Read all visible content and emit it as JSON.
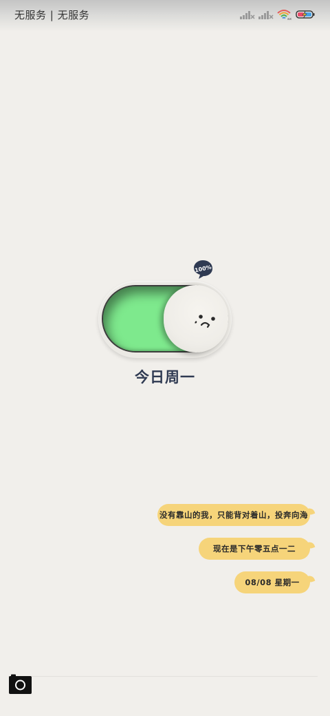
{
  "status_bar": {
    "carrier": "无服务 | 无服务",
    "icons": [
      "signal-off-icon",
      "signal-off-icon",
      "wifi-icon",
      "battery-charging-icon"
    ]
  },
  "widget": {
    "badge_text": "100%",
    "toggle_state": "on",
    "day": "今日周一",
    "track_color": "#7ee98d"
  },
  "messages": [
    "没有靠山的我，只能背对着山，投奔向海",
    "现在是下午零五点一二",
    "08/08 星期一"
  ],
  "bubble_color": "#f6d47a",
  "bottom": {
    "icons": [
      "camera-icon"
    ]
  }
}
